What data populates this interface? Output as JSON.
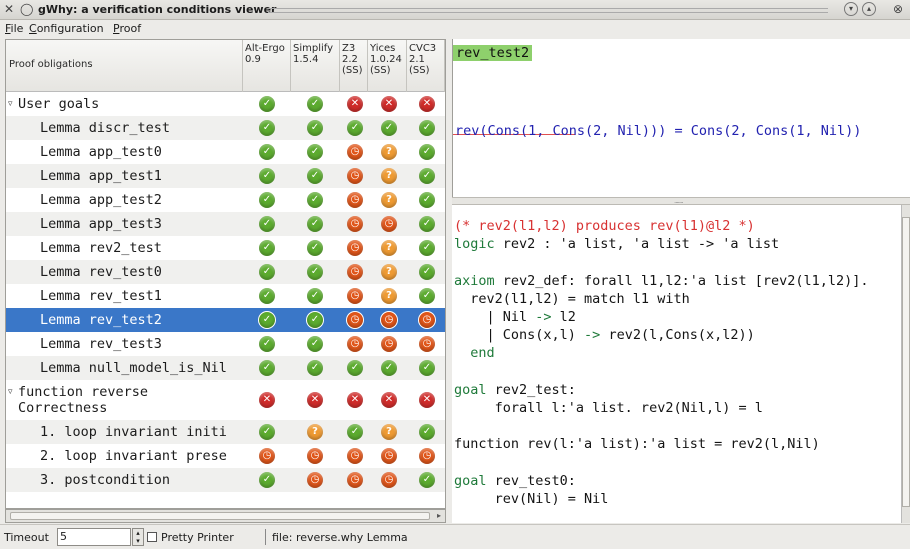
{
  "window": {
    "title": "gWhy: a verification conditions viewer",
    "menu": [
      "File",
      "Configuration",
      "Proof"
    ],
    "menu_mnemonics": [
      "F",
      "C",
      "P"
    ]
  },
  "status_colors": {
    "valid": "#5cab2f",
    "invalid": "#cf2c2a",
    "timeout": "#e0561a",
    "unknown": "#ee9a32",
    "selection": "#3a77c8",
    "goal_highlight": "#8ed06c"
  },
  "tree": {
    "header": {
      "proof_obligations": "Proof obligations",
      "provers": [
        {
          "lines": [
            "Alt-Ergo",
            "0.9"
          ]
        },
        {
          "lines": [
            "Simplify",
            "1.5.4"
          ]
        },
        {
          "lines": [
            "Z3",
            "2.2",
            "(SS)"
          ]
        },
        {
          "lines": [
            "Yices",
            "1.0.24",
            "(SS)"
          ]
        },
        {
          "lines": [
            "CVC3",
            "2.1",
            "(SS)"
          ]
        }
      ]
    },
    "rows": [
      {
        "label": "User goals",
        "indent": "group",
        "expander": "▿",
        "status": [
          "valid",
          "valid",
          "invalid",
          "invalid",
          "invalid"
        ]
      },
      {
        "label": "Lemma discr_test",
        "indent": "child",
        "status": [
          "valid",
          "valid",
          "valid",
          "valid",
          "valid"
        ]
      },
      {
        "label": "Lemma app_test0",
        "indent": "child",
        "status": [
          "valid",
          "valid",
          "timeout",
          "unknown",
          "valid"
        ]
      },
      {
        "label": "Lemma app_test1",
        "indent": "child",
        "status": [
          "valid",
          "valid",
          "timeout",
          "unknown",
          "valid"
        ]
      },
      {
        "label": "Lemma app_test2",
        "indent": "child",
        "status": [
          "valid",
          "valid",
          "timeout",
          "unknown",
          "valid"
        ]
      },
      {
        "label": "Lemma app_test3",
        "indent": "child",
        "status": [
          "valid",
          "valid",
          "timeout",
          "timeout",
          "valid"
        ]
      },
      {
        "label": "Lemma rev2_test",
        "indent": "child",
        "status": [
          "valid",
          "valid",
          "timeout",
          "unknown",
          "valid"
        ]
      },
      {
        "label": "Lemma rev_test0",
        "indent": "child",
        "status": [
          "valid",
          "valid",
          "timeout",
          "unknown",
          "valid"
        ]
      },
      {
        "label": "Lemma rev_test1",
        "indent": "child",
        "status": [
          "valid",
          "valid",
          "timeout",
          "unknown",
          "valid"
        ]
      },
      {
        "label": "Lemma rev_test2",
        "indent": "child",
        "selected": true,
        "status": [
          "valid",
          "valid",
          "timeout",
          "timeout",
          "timeout"
        ]
      },
      {
        "label": "Lemma rev_test3",
        "indent": "child",
        "status": [
          "valid",
          "valid",
          "timeout",
          "timeout",
          "timeout"
        ]
      },
      {
        "label": "Lemma null_model_is_Nil",
        "indent": "child",
        "status": [
          "valid",
          "valid",
          "valid",
          "valid",
          "valid"
        ]
      },
      {
        "label": "function reverse\nCorrectness",
        "indent": "group",
        "expander": "▿",
        "tall": true,
        "status": [
          "invalid",
          "invalid",
          "invalid",
          "invalid",
          "invalid"
        ]
      },
      {
        "label": "1. loop invariant initi",
        "indent": "child",
        "status": [
          "valid",
          "unknown",
          "valid",
          "unknown",
          "valid"
        ]
      },
      {
        "label": "2. loop invariant prese",
        "indent": "child",
        "status": [
          "timeout",
          "timeout",
          "timeout",
          "timeout",
          "timeout"
        ]
      },
      {
        "label": "3. postcondition",
        "indent": "child",
        "status": [
          "valid",
          "timeout",
          "timeout",
          "timeout",
          "valid"
        ]
      }
    ]
  },
  "goal": {
    "name": "rev_test2",
    "expression": "rev(Cons(1, Cons(2, Nil))) = Cons(2, Cons(1, Nil))"
  },
  "source": {
    "lines": [
      {
        "kind": "cm",
        "text": "(* rev2(l1,l2) produces rev(l1)@l2 *)"
      },
      {
        "kind": "kw-line",
        "kw": "logic",
        "text": " rev2 : 'a list, 'a list -> 'a list"
      },
      {
        "kind": "blank",
        "text": ""
      },
      {
        "kind": "kw-line",
        "kw": "axiom",
        "text": " rev2_def: forall l1,l2:'a list [rev2(l1,l2)]."
      },
      {
        "kind": "plain",
        "text": "  rev2(l1,l2) = match l1 with"
      },
      {
        "kind": "arrow",
        "text": "    | Nil ",
        "arrow": "->",
        "rest": " l2"
      },
      {
        "kind": "arrow",
        "text": "    | Cons(x,l) ",
        "arrow": "->",
        "rest": " rev2(l,Cons(x,l2))"
      },
      {
        "kind": "kw-indent",
        "indent": "  ",
        "kw": "end",
        "text": ""
      },
      {
        "kind": "blank",
        "text": ""
      },
      {
        "kind": "kw-line",
        "kw": "goal",
        "text": " rev2_test:"
      },
      {
        "kind": "plain",
        "text": "     forall l:'a list. rev2(Nil,l) = l"
      },
      {
        "kind": "blank",
        "text": ""
      },
      {
        "kind": "plain",
        "text": "function rev(l:'a list):'a list = rev2(l,Nil)"
      },
      {
        "kind": "blank",
        "text": ""
      },
      {
        "kind": "kw-line",
        "kw": "goal",
        "text": " rev_test0:"
      },
      {
        "kind": "plain",
        "text": "     rev(Nil) = Nil"
      }
    ]
  },
  "statusbar": {
    "timeout_label": "Timeout",
    "timeout_value": "5",
    "pretty_printer_label": "Pretty Printer",
    "pretty_printer_checked": false,
    "file_info": "file: reverse.why Lemma"
  }
}
